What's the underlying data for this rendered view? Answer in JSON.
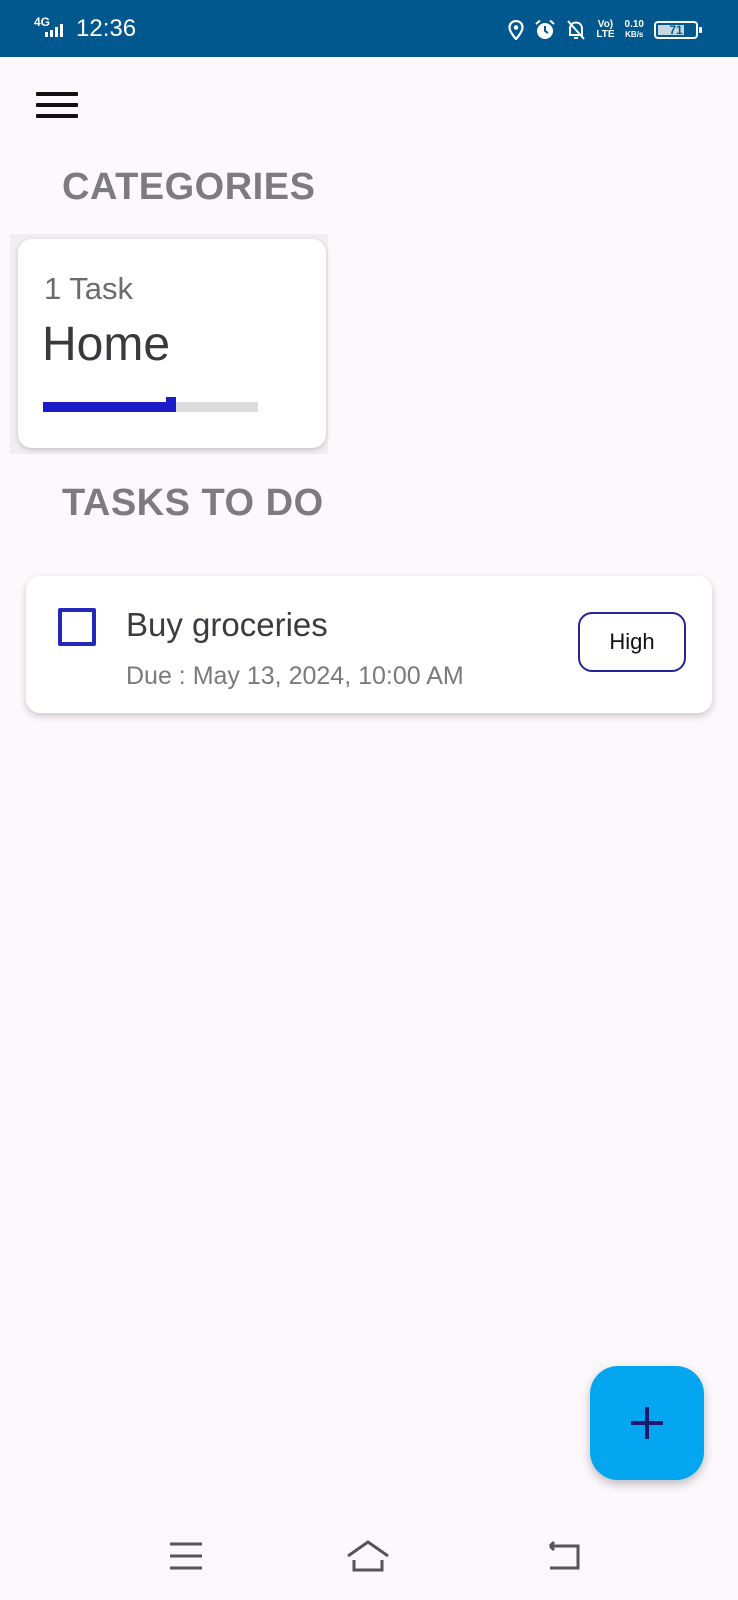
{
  "status_bar": {
    "network": "4G",
    "time": "12:36",
    "volte_top": "Vo)",
    "volte_bottom": "LTE",
    "speed_value": "0.10",
    "speed_unit": "KB/s",
    "battery": "71",
    "battery_level": 0.71,
    "icons": [
      "location-icon",
      "alarm-icon",
      "notifications-off-icon",
      "signal-icon",
      "battery-icon"
    ]
  },
  "toolbar": {
    "menu_icon": "hamburger-menu-icon"
  },
  "categories": {
    "heading": "CATEGORIES",
    "items": [
      {
        "count_label": "1 Task",
        "name": "Home",
        "progress": 0.6,
        "progress_color": "#1c1ccb"
      }
    ]
  },
  "tasks": {
    "heading": "TASKS TO DO",
    "items": [
      {
        "title": "Buy groceries",
        "due": "Due : May 13, 2024, 10:00 AM",
        "priority": "High",
        "checked": false
      }
    ]
  },
  "fab": {
    "icon": "plus-icon",
    "color": "#03a6ef"
  },
  "nav": {
    "icons": [
      "recent-apps-icon",
      "home-icon",
      "back-icon"
    ]
  },
  "colors": {
    "status_bar": "#01588f",
    "accent": "#2428b8",
    "background": "#fcf8fc"
  }
}
